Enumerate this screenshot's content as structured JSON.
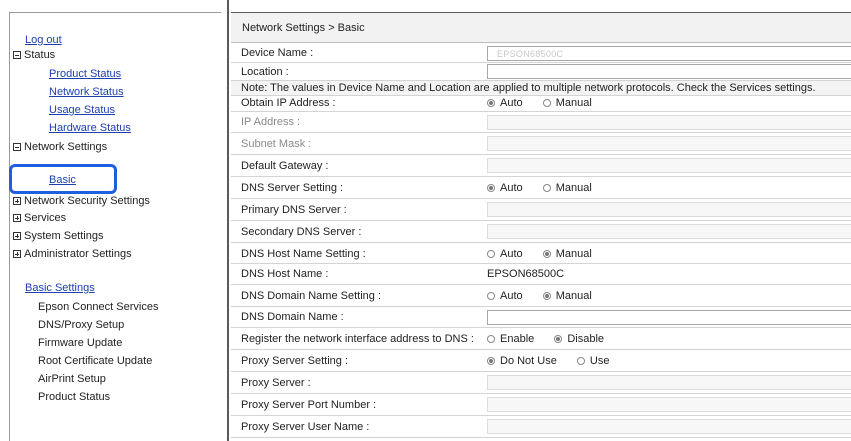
{
  "sidebar": {
    "logout": "Log out",
    "status_header": "Status",
    "status_items": [
      "Product Status",
      "Network Status",
      "Usage Status",
      "Hardware Status"
    ],
    "network_settings_header": "Network Settings",
    "basic": "Basic",
    "network_security_settings": "Network Security Settings",
    "services": "Services",
    "system_settings": "System Settings",
    "administrator_settings": "Administrator Settings",
    "basic_settings_link": "Basic Settings",
    "basic_settings_items": [
      "Epson Connect Services",
      "DNS/Proxy Setup",
      "Firmware Update",
      "Root Certificate Update",
      "AirPrint Setup",
      "Product Status"
    ]
  },
  "main": {
    "breadcrumb": "Network Settings > Basic",
    "device_name_label": "Device Name :",
    "device_name_value": "EPSON68500C",
    "location_label": "Location :",
    "note": "Note: The values in Device Name and Location are applied to multiple network protocols. Check the Services settings.",
    "obtain_ip_label": "Obtain IP Address :",
    "ip_address_label": "IP Address :",
    "subnet_mask_label": "Subnet Mask :",
    "default_gateway_label": "Default Gateway :",
    "dns_server_setting_label": "DNS Server Setting :",
    "primary_dns_label": "Primary DNS Server :",
    "secondary_dns_label": "Secondary DNS Server :",
    "dns_host_name_setting_label": "DNS Host Name Setting :",
    "dns_host_name_label": "DNS Host Name :",
    "dns_host_name_value": "EPSON68500C",
    "dns_domain_name_setting_label": "DNS Domain Name Setting :",
    "dns_domain_name_label": "DNS Domain Name :",
    "register_label": "Register the network interface address to DNS :",
    "proxy_server_setting_label": "Proxy Server Setting :",
    "proxy_server_label": "Proxy Server :",
    "proxy_port_label": "Proxy Server Port Number :",
    "proxy_user_label": "Proxy Server User Name :",
    "opt_auto": "Auto",
    "opt_manual": "Manual",
    "opt_enable": "Enable",
    "opt_disable": "Disable",
    "opt_do_not_use": "Do Not Use",
    "opt_use": "Use"
  },
  "colors": {
    "link": "#1d3fb0",
    "highlight": "#1e5fe0"
  }
}
